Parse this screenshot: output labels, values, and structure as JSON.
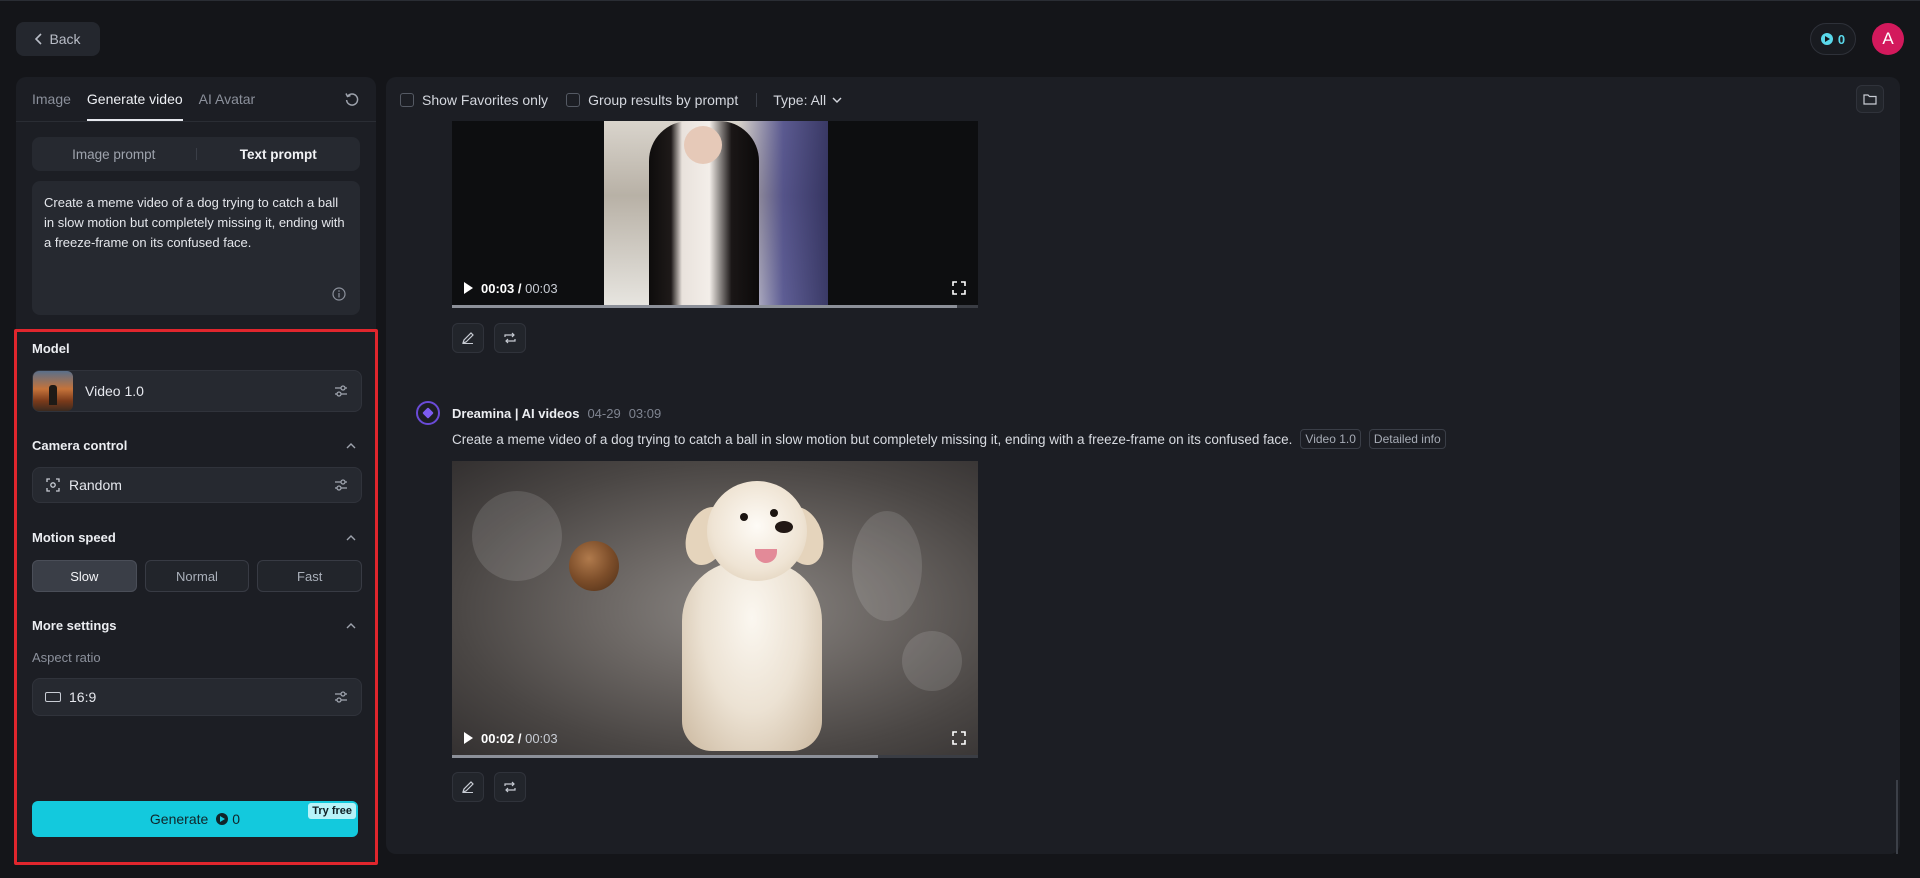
{
  "header": {
    "back_label": "Back",
    "credits": "0",
    "avatar_letter": "A"
  },
  "sidebar": {
    "tabs": [
      {
        "label": "Image",
        "active": false
      },
      {
        "label": "Generate video",
        "active": true
      },
      {
        "label": "AI Avatar",
        "active": false
      }
    ],
    "prompt_modes": [
      {
        "label": "Image prompt",
        "active": false
      },
      {
        "label": "Text prompt",
        "active": true
      }
    ],
    "prompt_text": "Create a meme video of a dog trying to catch a ball in slow motion but completely missing it, ending with a freeze-frame on its confused face.",
    "model": {
      "section_label": "Model",
      "name": "Video 1.0"
    },
    "camera": {
      "section_label": "Camera control",
      "value": "Random"
    },
    "motion": {
      "section_label": "Motion speed",
      "options": [
        {
          "label": "Slow",
          "active": true
        },
        {
          "label": "Normal",
          "active": false
        },
        {
          "label": "Fast",
          "active": false
        }
      ]
    },
    "more": {
      "section_label": "More settings",
      "aspect_label": "Aspect ratio",
      "aspect_value": "16:9"
    },
    "generate": {
      "label": "Generate",
      "cost": "0",
      "badge": "Try free"
    },
    "accent_color": "#13c9dd",
    "highlight_color": "#e0262d"
  },
  "main": {
    "toolbar": {
      "favorites_label": "Show Favorites only",
      "group_label": "Group results by prompt",
      "type_label": "Type: All"
    },
    "videos": [
      {
        "time_current": "00:03",
        "time_total": "00:03",
        "progress": 0.96
      },
      {
        "author": "Dreamina | AI videos",
        "date": "04-29",
        "time": "03:09",
        "prompt": "Create a meme video of a dog trying to catch a ball in slow motion but completely missing it, ending with a freeze-frame on its confused face.",
        "tags": [
          "Video 1.0",
          "Detailed info"
        ],
        "time_current": "00:02",
        "time_total": "00:03",
        "progress": 0.81
      }
    ]
  }
}
